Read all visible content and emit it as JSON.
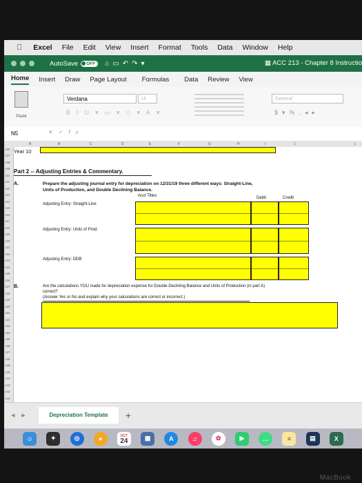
{
  "menubar": {
    "apple_icon": "apple-icon",
    "app_name": "Excel",
    "items": [
      "File",
      "Edit",
      "View",
      "Insert",
      "Format",
      "Tools",
      "Data",
      "Window",
      "Help"
    ]
  },
  "titlebar": {
    "autosave_label": "AutoSave",
    "autosave_state": "OFF",
    "document_title": "ACC 213 - Chapter 8 Instructio"
  },
  "ribbon": {
    "tabs": [
      "Home",
      "Insert",
      "Draw",
      "Page Layout",
      "Formulas",
      "Data",
      "Review",
      "View"
    ],
    "active_tab": "Home",
    "paste_label": "Paste",
    "font_name": "Verdana",
    "font_size": "14",
    "number_format": "General"
  },
  "formula_bar": {
    "name_box": "N5",
    "fx_label": "fx"
  },
  "grid": {
    "columns": [
      "A",
      "B",
      "C",
      "D",
      "E",
      "F",
      "G",
      "H",
      "I",
      "J",
      "L"
    ],
    "rows": [
      "106",
      "107",
      "108",
      "109",
      "110",
      "111",
      "112",
      "113",
      "114",
      "115",
      "116",
      "117",
      "118",
      "119",
      "120",
      "121",
      "122",
      "123",
      "124",
      "125",
      "126",
      "127",
      "128",
      "129",
      "130",
      "131",
      "132",
      "133",
      "134",
      "135",
      "136",
      "137",
      "138",
      "139",
      "140",
      "141",
      "142",
      "143",
      "144"
    ],
    "year_label": "Year 10",
    "part2_heading": "Part 2 -- Adjusting Entries & Commentary.",
    "section_a": "A.",
    "prompt_a_line1": "Prepare the adjusting journal entry for depreciation on 12/31/19 three different ways: Straight-Line,",
    "prompt_a_line2": "Units of Production, and Double Declining Balance.",
    "acct_titles": "Acct Titles",
    "debit": "Debit",
    "credit": "Credit",
    "entry_sl": "Adjusting Entry: Straight-Line",
    "entry_up": "Adjusting Entry: Units of Prod.",
    "entry_ddb": "Adjusting Entry: DDB",
    "section_b": "B.",
    "prompt_b_line1": "Are the calculations YOU made for depreciation expense for Double-Declining Balance and Units of Production (in part A)",
    "prompt_b_line2": "correct?",
    "prompt_b_line3": "(Answer Yes or No and explain why your calculations are correct or incorrect.)"
  },
  "sheet": {
    "tab_name": "Depreciation Template",
    "add_sheet": "+"
  },
  "dock": {
    "calendar_month": "OCT",
    "calendar_day": "24"
  },
  "bezel": {
    "brand": "MacBook"
  },
  "colors": {
    "excel_green": "#1e7145",
    "highlight_yellow": "#ffff00"
  }
}
